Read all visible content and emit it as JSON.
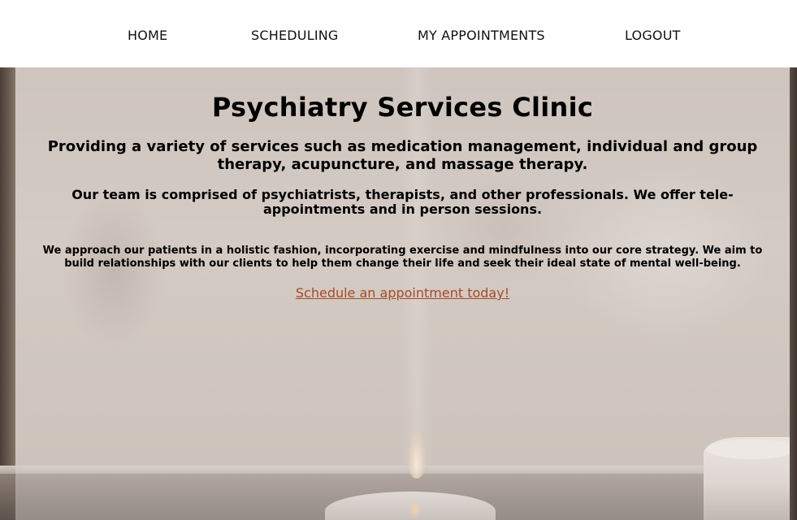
{
  "nav": {
    "items": [
      {
        "label": "HOME"
      },
      {
        "label": "SCHEDULING"
      },
      {
        "label": "MY APPOINTMENTS"
      },
      {
        "label": "LOGOUT"
      }
    ]
  },
  "main": {
    "title": "Psychiatry Services Clinic",
    "tagline": "Providing a variety of services such as medication management, individual and group therapy, acupuncture, and massage therapy.",
    "team": "Our team is comprised of psychiatrists, therapists, and other professionals. We offer tele-appointments and in person sessions.",
    "approach": "We approach our patients in a holistic fashion, incorporating exercise and mindfulness into our core strategy. We aim to build relationships with our clients to help them change their life and seek their ideal state of mental well-being.",
    "cta_link": "Schedule an appointment today!"
  },
  "colors": {
    "link": "#a64b2a",
    "text": "#000000",
    "nav_background": "#ffffff"
  }
}
